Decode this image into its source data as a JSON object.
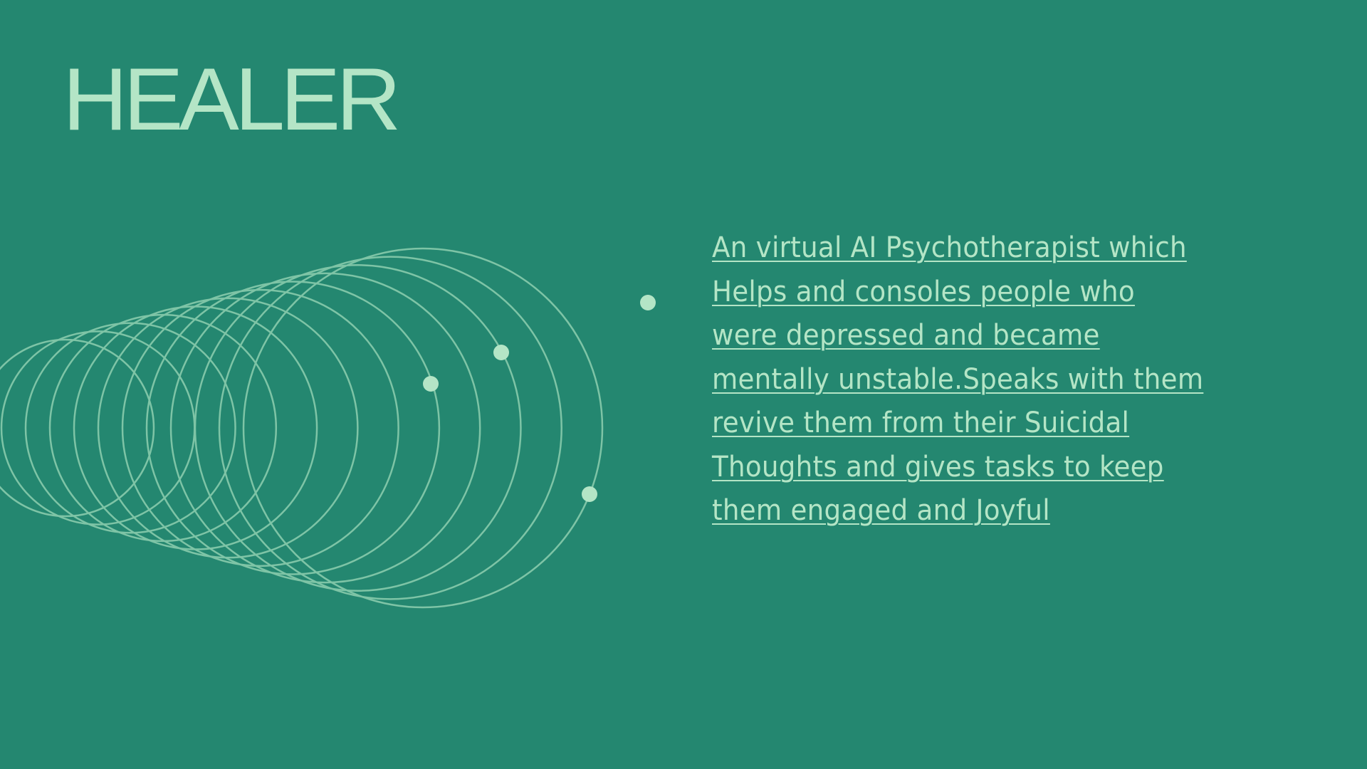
{
  "title": "HEALER",
  "description": {
    "lines": [
      "An virtual AI Psychotherapist which",
      "Helps and consoles people who",
      "were depressed and became",
      "mentally unstable.Speaks with them",
      "revive them from their Suicidal",
      "Thoughts and gives tasks to keep",
      "them engaged and Joyful"
    ]
  },
  "colors": {
    "background": "#248770",
    "text": "#b4e5c6",
    "rings": "#7ec4a6",
    "dots": "#b4e5c6"
  }
}
